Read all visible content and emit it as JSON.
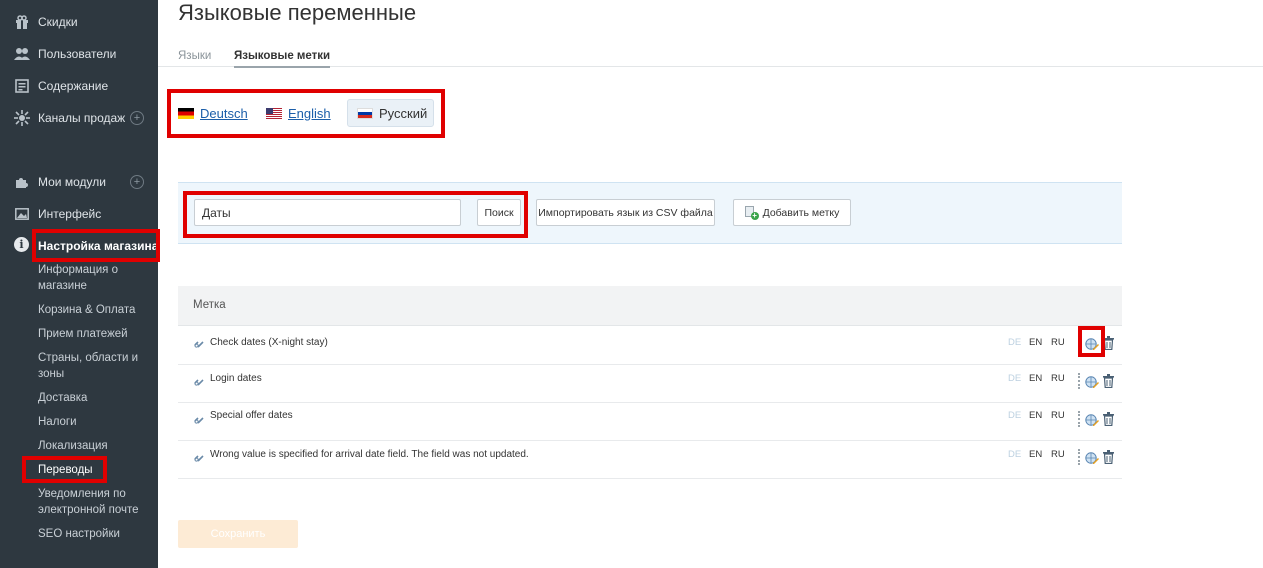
{
  "sidebar": {
    "items": [
      {
        "label": "Скидки",
        "icon": "gift-icon"
      },
      {
        "label": "Пользователи",
        "icon": "users-icon"
      },
      {
        "label": "Содержание",
        "icon": "content-icon"
      },
      {
        "label": "Каналы продаж",
        "icon": "sales-channels-icon"
      },
      {
        "label": "Мои модули",
        "icon": "puzzle-icon"
      },
      {
        "label": "Интерфейс",
        "icon": "image-icon"
      },
      {
        "label": "Настройка магазина",
        "icon": "info-icon"
      }
    ],
    "sub_items": [
      "Информация о магазине",
      "Корзина & Оплата",
      "Прием платежей",
      "Страны, области и зоны",
      "Доставка",
      "Налоги",
      "Локализация",
      "Переводы",
      "Уведомления по электронной почте",
      "SEO настройки"
    ]
  },
  "page": {
    "title": "Языковые переменные",
    "tabs": [
      "Языки",
      "Языковые метки"
    ],
    "active_tab": "Языковые метки"
  },
  "languages": {
    "items": [
      "Deutsch",
      "English",
      "Русский"
    ],
    "current": "Русский"
  },
  "toolbar": {
    "search_value": "Даты",
    "search_button": "Поиск",
    "import_button": "Импортировать язык из CSV файла",
    "add_button": "Добавить метку"
  },
  "table": {
    "header": "Метка",
    "rows": [
      {
        "label": "Check dates (X-night stay)"
      },
      {
        "label": "Login dates"
      },
      {
        "label": "Special offer dates"
      },
      {
        "label": "Wrong value is specified for arrival date field. The field was not updated."
      }
    ],
    "lang_codes": [
      "DE",
      "EN",
      "RU"
    ]
  },
  "save_button": "Сохранить",
  "colors": {
    "sidebar_bg": "#2e3840",
    "highlight": "#e00000",
    "link": "#1b5ea9",
    "toolbar_bg": "#eef6fc"
  }
}
